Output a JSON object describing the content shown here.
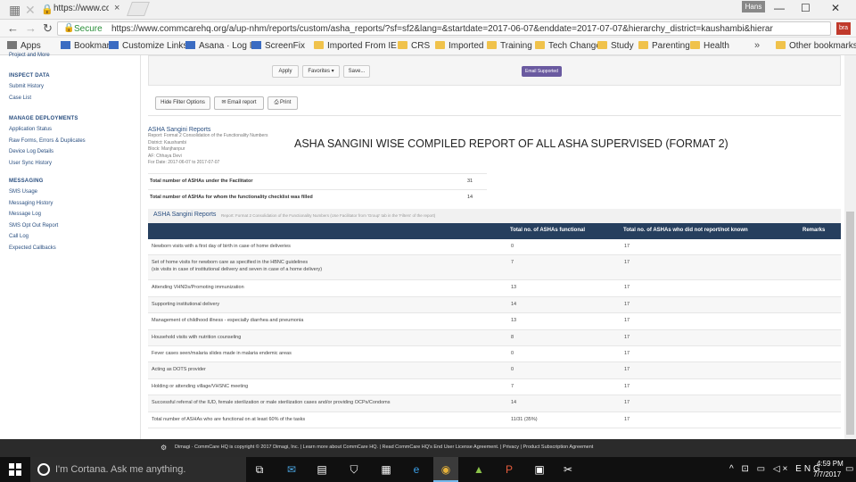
{
  "browser": {
    "tab_url_fragment": "https://www.commcarch",
    "tab_close": "×",
    "user_badge": "Hans",
    "win_min": "—",
    "win_max": "☐",
    "win_close": "✕",
    "secure_label": "Secure",
    "url": "https://www.commcarehq.org/a/up-nhm/reports/custom/asha_reports/?sf=sf2&lang=&startdate=2017-06-07&enddate=2017-07-07&hierarchy_district=kaushambi&hierar",
    "ext_label": "bra",
    "bookmarks": [
      {
        "label": "Apps",
        "icon": "grid"
      },
      {
        "label": "Bookmarks",
        "icon": "page"
      },
      {
        "label": "Customize Links",
        "icon": "page"
      },
      {
        "label": "Asana · Log In",
        "icon": "page"
      },
      {
        "label": "ScreenFix",
        "icon": "page"
      },
      {
        "label": "Imported From IE",
        "icon": "fold"
      },
      {
        "label": "CRS",
        "icon": "fold"
      },
      {
        "label": "Imported",
        "icon": "fold"
      },
      {
        "label": "Training",
        "icon": "fold"
      },
      {
        "label": "Tech Change",
        "icon": "fold"
      },
      {
        "label": "Study",
        "icon": "fold"
      },
      {
        "label": "Parenting",
        "icon": "fold"
      },
      {
        "label": "Health",
        "icon": "fold"
      }
    ],
    "bookmarks_more": "»",
    "other_bookmarks": "Other bookmarks"
  },
  "sidebar": {
    "top_link": "Project and More",
    "sections": [
      {
        "heading": "INSPECT DATA",
        "links": [
          "Submit History",
          "Case List"
        ]
      },
      {
        "heading": "MANAGE DEPLOYMENTS",
        "links": [
          "Application Status",
          "Raw Forms, Errors & Duplicates",
          "Device Log Details",
          "User Sync History"
        ]
      },
      {
        "heading": "MESSAGING",
        "links": [
          "SMS Usage",
          "Messaging History",
          "Message Log",
          "SMS Opt Out Report",
          "Call Log",
          "Expected Callbacks"
        ]
      }
    ]
  },
  "filters": {
    "apply": "Apply",
    "favorites": "Favorites ▾",
    "save": "Save...",
    "email_supported": "Email Supported"
  },
  "actions": {
    "hide_filter": "Hide Filter Options",
    "email_report": "✉ Email report",
    "print": "⎙ Print"
  },
  "report_meta": {
    "title": "ASHA Sangini Reports",
    "lines": [
      "Report: Format 2 Consolidation of the Functionality Numbers",
      "District: Kaushambi",
      "Block: Manjhanpur",
      "AF: Chhaya Devi",
      "For Date: 2017-06-07 to 2017-07-07"
    ]
  },
  "overlay_heading": "ASHA SANGINI WISE COMPILED REPORT OF ALL ASHA SUPERVISED (FORMAT 2)",
  "summary": [
    {
      "label": "Total number of ASHAs under the Facilitator",
      "value": "31"
    },
    {
      "label": "Total number of ASHAs for whom the functionality checklist was filled",
      "value": "14"
    }
  ],
  "report2": {
    "title": "ASHA Sangini Reports",
    "description": "Report: Format 2 Consolidation of the Functionality Numbers (Use Facilitator from 'Group' tab in the 'Filters' of the report)"
  },
  "table": {
    "headers": [
      "",
      "Total no. of ASHAs functional",
      "Total no. of ASHAs who did not report/not known",
      "Remarks"
    ],
    "rows": [
      {
        "task": "Newborn visits with a first day of birth in case of home deliveries",
        "task2": "",
        "functional": "0",
        "not_known": "17",
        "remarks": ""
      },
      {
        "task": "Set of home visits for newborn care as specified in the HBNC guidelines",
        "task2": "(six visits in case of institutional delivery and seven in case of a home delivery)",
        "functional": "7",
        "not_known": "17",
        "remarks": ""
      },
      {
        "task": "Attending VHNDs/Promoting immunization",
        "task2": "",
        "functional": "13",
        "not_known": "17",
        "remarks": ""
      },
      {
        "task": "Supporting institutional delivery",
        "task2": "",
        "functional": "14",
        "not_known": "17",
        "remarks": ""
      },
      {
        "task": "Management of childhood illness - especially diarrhea and pneumonia",
        "task2": "",
        "functional": "13",
        "not_known": "17",
        "remarks": ""
      },
      {
        "task": "Household visits with nutrition counseling",
        "task2": "",
        "functional": "8",
        "not_known": "17",
        "remarks": ""
      },
      {
        "task": "Fever cases seen/malaria slides made in malaria endemic areas",
        "task2": "",
        "functional": "0",
        "not_known": "17",
        "remarks": ""
      },
      {
        "task": "Acting as DOTS provider",
        "task2": "",
        "functional": "0",
        "not_known": "17",
        "remarks": ""
      },
      {
        "task": "Holding or attending village/VHSNC meeting",
        "task2": "",
        "functional": "7",
        "not_known": "17",
        "remarks": ""
      },
      {
        "task": "Successful referral of the IUD, female sterilization or male sterilization cases and/or providing OCPs/Condoms",
        "task2": "",
        "functional": "14",
        "not_known": "17",
        "remarks": ""
      },
      {
        "task": "Total number of ASHAs who are functional on at least 60% of the tasks",
        "task2": "",
        "functional": "11/31 (35%)",
        "not_known": "17",
        "remarks": ""
      }
    ]
  },
  "footer": {
    "logo": "⚙",
    "text": "Dimagi · CommCare HQ is copyright © 2017 Dimagi, Inc. | Learn more about CommCare HQ. | Read CommCare HQ's End User License Agreement. | Privacy | Product Subscription Agreement"
  },
  "taskbar": {
    "cortana_placeholder": "I'm Cortana. Ask me anything.",
    "tray": "^ ⊡ ▭ ◁× ENG",
    "time": "4:59 PM",
    "date": "7/7/2017",
    "notif": "▭"
  }
}
